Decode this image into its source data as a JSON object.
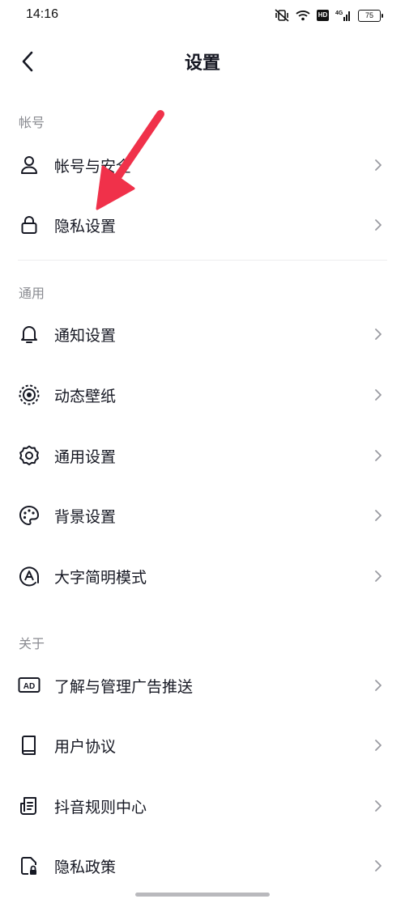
{
  "status_bar": {
    "time": "14:16",
    "network": "4G",
    "hd": "HD",
    "battery": "75"
  },
  "header": {
    "title": "设置"
  },
  "sections": [
    {
      "header": "帐号",
      "items": [
        {
          "label": "帐号与安全",
          "icon": "user-icon"
        },
        {
          "label": "隐私设置",
          "icon": "lock-icon"
        }
      ]
    },
    {
      "header": "通用",
      "items": [
        {
          "label": "通知设置",
          "icon": "bell-icon"
        },
        {
          "label": "动态壁纸",
          "icon": "live-wallpaper-icon"
        },
        {
          "label": "通用设置",
          "icon": "gear-icon"
        },
        {
          "label": "背景设置",
          "icon": "palette-icon"
        },
        {
          "label": "大字简明模式",
          "icon": "large-font-icon"
        }
      ]
    },
    {
      "header": "关于",
      "items": [
        {
          "label": "了解与管理广告推送",
          "icon": "ad-icon",
          "icon_text": "AD"
        },
        {
          "label": "用户协议",
          "icon": "book-icon"
        },
        {
          "label": "抖音规则中心",
          "icon": "document-icon"
        },
        {
          "label": "隐私政策",
          "icon": "privacy-policy-icon"
        }
      ]
    }
  ],
  "colors": {
    "text": "#161823",
    "secondary": "#8a8b91",
    "annotation_arrow": "#f0314a",
    "divider": "#ececee"
  }
}
